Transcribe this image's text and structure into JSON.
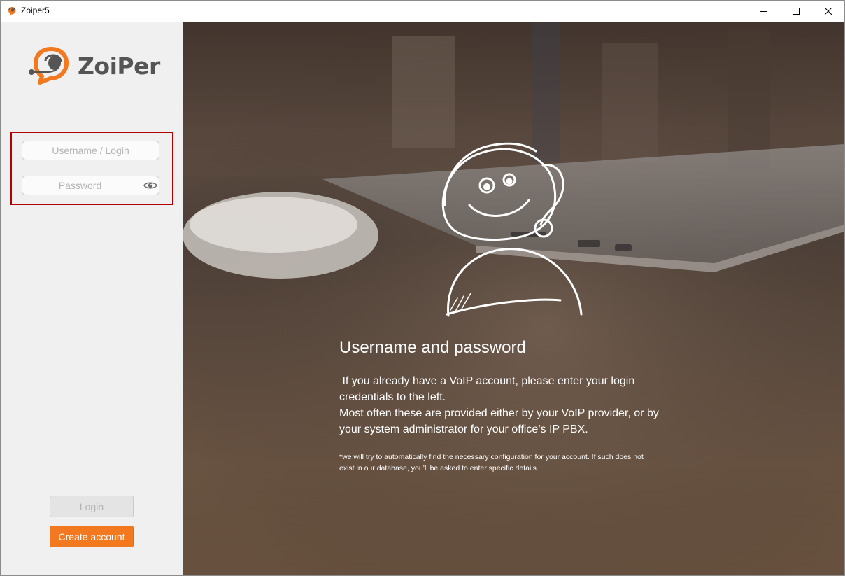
{
  "window": {
    "title": "Zoiper5",
    "controls": [
      "minimize-icon",
      "maximize-icon",
      "close-icon"
    ]
  },
  "sidebar": {
    "logo_text": "ZoiPer",
    "username_placeholder": "Username / Login",
    "password_placeholder": "Password",
    "username_value": "",
    "password_value": "",
    "login_label": "Login",
    "create_account_label": "Create account"
  },
  "hero": {
    "title": "Username and password",
    "paragraph1": " If you already have a VoIP account, please enter your login credentials to the left.",
    "paragraph2": "Most often these are provided either by your VoIP provider, or by your system administrator for your office’s IP PBX.",
    "note": "*we will try to automatically find the necessary configuration for your account. If such does not exist in our database, you’ll be asked to enter specific details."
  },
  "colors": {
    "accent": "#f37920",
    "highlight_border": "#b00000",
    "sidebar_bg": "#f0f0f0",
    "logo_text": "#555555"
  }
}
